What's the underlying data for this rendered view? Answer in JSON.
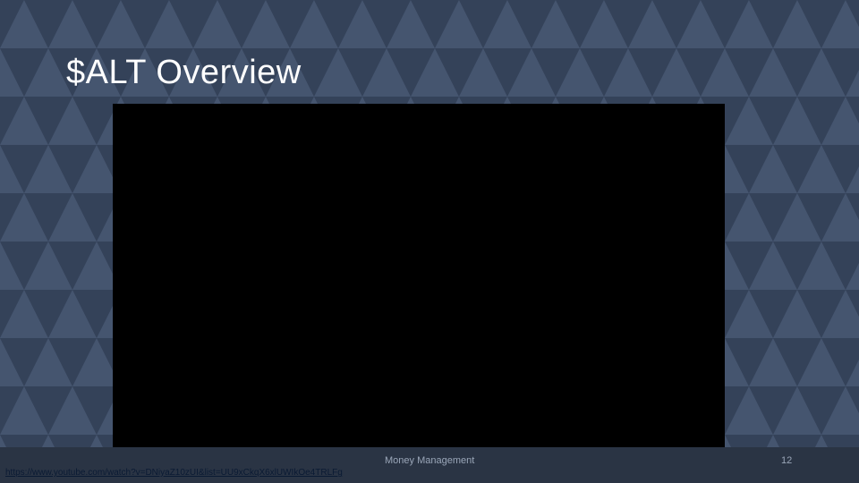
{
  "slide": {
    "title": "$ALT Overview",
    "video_link": "https://www.youtube.com/watch?v=DNiyaZ10zUI&list=UU9xCkqX6xlUWIkOe4TRLFg",
    "footer_text": "Money Management",
    "page_number": "12"
  },
  "colors": {
    "background": "#3b4a63",
    "triangle_light": "#45556f",
    "triangle_dark": "#344259",
    "footer_band": "#2a3444",
    "title_text": "#ffffff",
    "video_frame": "#000000",
    "footer_text": "#9aa6b8",
    "link_text": "#0a1a33"
  }
}
